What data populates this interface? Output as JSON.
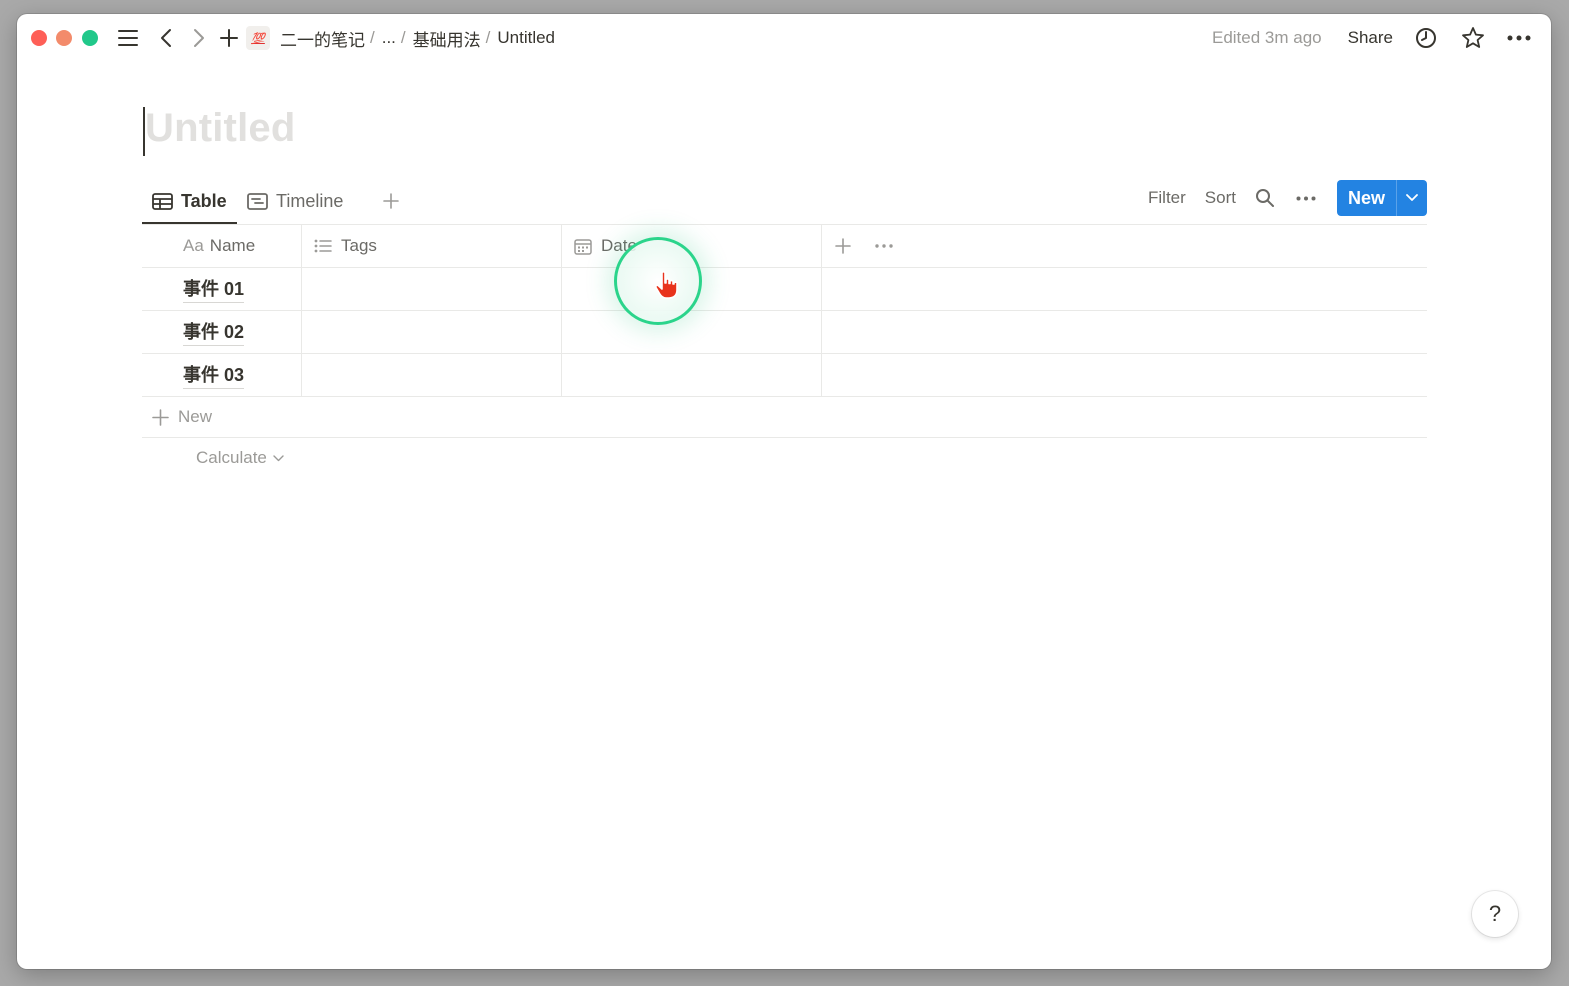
{
  "breadcrumb": {
    "emoji": "💯",
    "items": [
      "二一的笔记",
      "...",
      "基础用法",
      "Untitled"
    ],
    "separator": "/"
  },
  "topbar": {
    "edited": "Edited 3m ago",
    "share": "Share"
  },
  "page": {
    "title_placeholder": "Untitled"
  },
  "views": {
    "tabs": [
      {
        "label": "Table",
        "active": true
      },
      {
        "label": "Timeline",
        "active": false
      }
    ],
    "actions": {
      "filter": "Filter",
      "sort": "Sort",
      "new": "New"
    }
  },
  "table": {
    "columns": [
      {
        "icon": "Aa",
        "label": "Name"
      },
      {
        "icon": "list-icon",
        "label": "Tags"
      },
      {
        "icon": "calendar-icon",
        "label": "Date"
      }
    ],
    "rows": [
      {
        "name": "事件 01",
        "tags": "",
        "date": ""
      },
      {
        "name": "事件 02",
        "tags": "",
        "date": ""
      },
      {
        "name": "事件 03",
        "tags": "",
        "date": ""
      }
    ],
    "new_row": "New",
    "calculate": "Calculate"
  },
  "help": "?",
  "colors": {
    "accent": "#2383e2",
    "click_ring": "#2bd48b",
    "cursor": "#e8331c"
  }
}
